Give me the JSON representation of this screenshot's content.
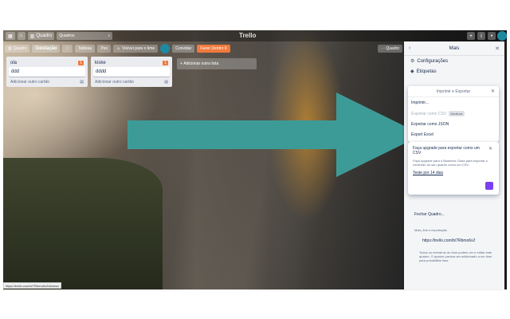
{
  "topbar": {
    "boards_label": "Quadro",
    "search_value": "",
    "search_placeholder": "Quadros",
    "logo": "Trello",
    "plus_label": "+",
    "info_label": "i",
    "bell_label": "•"
  },
  "boardbar": {
    "board_menu": "Quadro",
    "board_name": "Gestação",
    "star_label": "☆",
    "org_label": "Tableau",
    "personal_label": "Pes",
    "visibility_label": "Visível para o time",
    "other_label": "Convidar",
    "power_label": "Fazer Dentro 9"
  },
  "lists": [
    {
      "title": "ola",
      "badge": "1",
      "cards": [
        "ddd"
      ],
      "add_label": "Adicionar outro cartão"
    },
    {
      "title": "kiske",
      "badge": "1",
      "cards": [
        "dddd"
      ],
      "add_label": "Adicionar outro cartão"
    }
  ],
  "add_list_label": "Adicionar outra lista",
  "menu_button": "Quadro",
  "sidebar": {
    "title": "Mais",
    "back_icon": "‹",
    "close_icon": "✕",
    "items": [
      {
        "icon": "⚙",
        "label": "Configurações"
      },
      {
        "icon": "◆",
        "label": "Etiquetas"
      }
    ]
  },
  "popup": {
    "title": "Imprimir e Exportar",
    "close": "✕",
    "items": [
      {
        "label": "Imprimir...",
        "muted": false,
        "badge": ""
      },
      {
        "label": "Exportar como CSV",
        "muted": true,
        "badge": "Atualizar"
      },
      {
        "label": "Exportar como JSON",
        "muted": false,
        "badge": ""
      },
      {
        "label": "Export Excel",
        "muted": false,
        "badge": ""
      }
    ]
  },
  "upgrade": {
    "title": "Faça upgrade para exportar como um CSV",
    "body": "Faça upgrade para o Business Class para exportar o conteúdo do seu quadro como um CSV.",
    "link": "Teste por 14 dias",
    "close": "✕"
  },
  "sidebar_low": {
    "close_board": "Fechar Quadro...",
    "share_label": "Mais, link e exportação",
    "link": "https://trello.com/b/7Rbmo6x2",
    "note": "Todos os membros do time podem ver e editar este quadro. O quadro precisa ser adicionado a um time para possibilitar isso."
  },
  "status_url": "https://trello.com/b/7Rbmo6x2/deseux"
}
